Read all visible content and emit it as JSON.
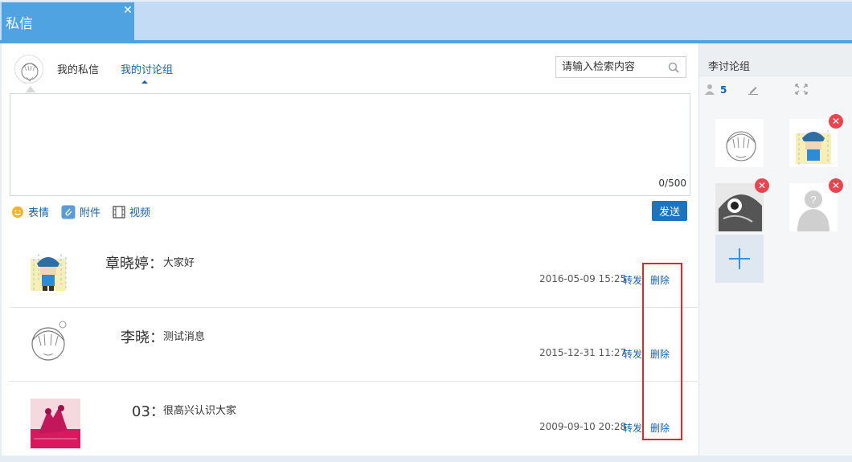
{
  "window": {
    "tab_title": "私信",
    "close_label": "✕"
  },
  "nav": {
    "tabs": [
      {
        "label": "我的私信"
      },
      {
        "label": "我的讨论组"
      }
    ],
    "active_tab": "我的讨论组"
  },
  "search": {
    "placeholder": "请输入检索内容"
  },
  "composer": {
    "char_count": "0/500",
    "tools": {
      "emoji_label": "表情",
      "attach_label": "附件",
      "video_label": "视频"
    },
    "send_label": "发送"
  },
  "messages": [
    {
      "name": "章晓婷",
      "text": "大家好",
      "time": "2016-05-09 15:25",
      "forward": "转发",
      "delete": "删除"
    },
    {
      "name": "李晓",
      "text": "测试消息",
      "time": "2015-12-31 11:27",
      "forward": "转发",
      "delete": "删除"
    },
    {
      "name": "03",
      "text": "很高兴认识大家",
      "time": "2009-09-10 20:28",
      "forward": "转发",
      "delete": "删除"
    }
  ],
  "sidebar": {
    "title": "李讨论组",
    "member_count": "5"
  },
  "colors": {
    "accent": "#4fa3e0",
    "link": "#1b5f9f",
    "send_button": "#1d74bd",
    "highlight": "#e0262e",
    "remove_badge": "#e8464f"
  }
}
